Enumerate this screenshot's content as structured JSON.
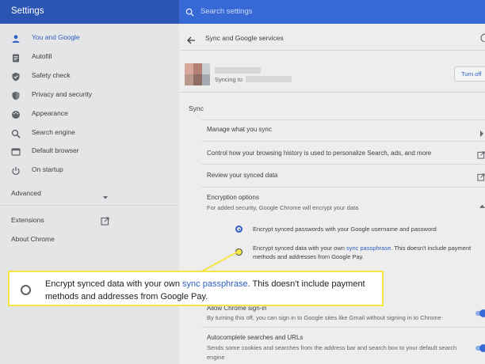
{
  "app": {
    "title": "Settings"
  },
  "search": {
    "placeholder": "Search settings"
  },
  "sidebar": {
    "items": [
      {
        "label": "You and Google",
        "icon": "person-icon",
        "active": true
      },
      {
        "label": "Autofill",
        "icon": "clipboard-icon"
      },
      {
        "label": "Safety check",
        "icon": "shield-check-icon"
      },
      {
        "label": "Privacy and security",
        "icon": "shield-icon"
      },
      {
        "label": "Appearance",
        "icon": "palette-icon"
      },
      {
        "label": "Search engine",
        "icon": "search-icon"
      },
      {
        "label": "Default browser",
        "icon": "browser-icon"
      },
      {
        "label": "On startup",
        "icon": "power-icon"
      }
    ],
    "advanced_label": "Advanced",
    "extensions_label": "Extensions",
    "about_label": "About Chrome"
  },
  "page": {
    "title": "Sync and Google services",
    "account": {
      "syncing_text": "Syncing to",
      "turn_off_label": "Turn off"
    },
    "sync_heading": "Sync",
    "rows": {
      "manage": "Manage what you sync",
      "history": "Control how your browsing history is used to personalize Search, ads, and more",
      "review": "Review your synced data"
    },
    "encryption": {
      "title": "Encryption options",
      "subtitle": "For added security, Google Chrome will encrypt your data",
      "option1": "Encrypt synced passwords with your Google username and password",
      "option2_pre": "Encrypt synced data with your own ",
      "option2_link": "sync passphrase",
      "option2_post": ". This doesn't include payment",
      "option2_line2": "methods and addresses from Google Pay."
    },
    "allow_signin": {
      "title": "Allow Chrome sign-in",
      "desc": "By turning this off, you can sign in to Google sites like Gmail without signing in to Chrome"
    },
    "autocomplete": {
      "title": "Autocomplete searches and URLs",
      "desc_line1": "Sends some cookies and searches from the address bar and search box to your default search",
      "desc_line2": "engine"
    }
  },
  "callout": {
    "text_pre": "Encrypt synced data with your own ",
    "link": "sync passphrase",
    "text_post": ". This doesn't include payment methods and addresses from Google Pay."
  },
  "colors": {
    "accent": "#2f5ec4",
    "highlight": "#f5e646"
  }
}
